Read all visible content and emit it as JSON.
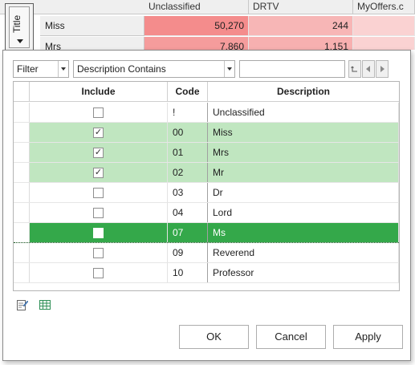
{
  "background_grid": {
    "title_tab": "Title",
    "columns": [
      "Unclassified",
      "DRTV",
      "MyOffers.c"
    ],
    "rows": [
      {
        "label": "Miss",
        "values": [
          "50,270",
          "244",
          ""
        ]
      },
      {
        "label": "Mrs",
        "values": [
          "7,860",
          "1,151",
          ""
        ]
      }
    ],
    "colors": {
      "heat_strong": "#f48c8c",
      "heat_medium": "#f6acac",
      "heat_light": "#fbd0d0"
    }
  },
  "filter_bar": {
    "field_select": "Filter",
    "operator_select": "Description Contains",
    "value_input": "",
    "buttons": {
      "undo_icon": "undo-arrow-icon",
      "prev_icon": "triangle-left-icon",
      "next_icon": "triangle-right-icon"
    }
  },
  "grid": {
    "columns": {
      "include": "Include",
      "code": "Code",
      "description": "Description"
    },
    "rows": [
      {
        "checked": false,
        "code": "!",
        "description": "Unclassified",
        "state": "normal"
      },
      {
        "checked": true,
        "code": "00",
        "description": "Miss",
        "state": "included"
      },
      {
        "checked": true,
        "code": "01",
        "description": "Mrs",
        "state": "included"
      },
      {
        "checked": true,
        "code": "02",
        "description": "Mr",
        "state": "included"
      },
      {
        "checked": false,
        "code": "03",
        "description": "Dr",
        "state": "normal"
      },
      {
        "checked": false,
        "code": "04",
        "description": "Lord",
        "state": "normal"
      },
      {
        "checked": false,
        "code": "07",
        "description": "Ms",
        "state": "focused"
      },
      {
        "checked": false,
        "code": "09",
        "description": "Reverend",
        "state": "normal"
      },
      {
        "checked": false,
        "code": "10",
        "description": "Professor",
        "state": "normal"
      }
    ],
    "colors": {
      "included_row": "#c0e6c0",
      "focused_row": "#34a84a"
    }
  },
  "bottom_icons": [
    "edit-list-icon",
    "grid-table-icon"
  ],
  "buttons": {
    "ok": "OK",
    "cancel": "Cancel",
    "apply": "Apply"
  }
}
